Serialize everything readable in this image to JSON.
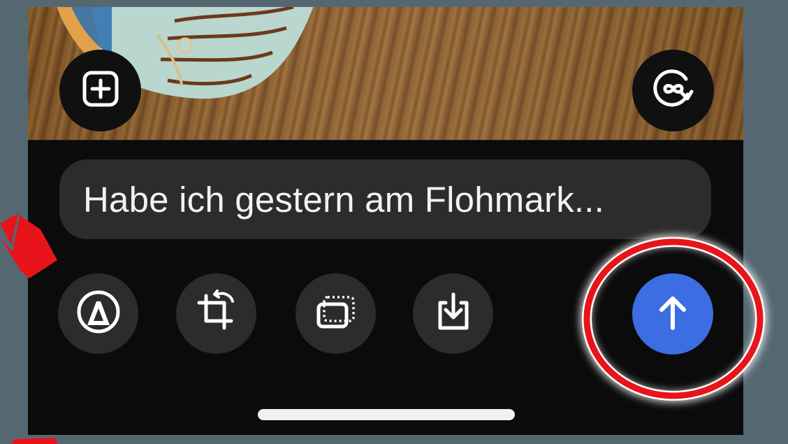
{
  "caption": {
    "text": "Habe ich gestern am Flohmark..."
  },
  "photo": {
    "icons": [
      "add-sticker-icon",
      "loop-icon"
    ]
  },
  "toolbar": {
    "icons": [
      "markup-pen-icon",
      "crop-rotate-icon",
      "aspect-ratio-icon",
      "download-icon",
      "send-arrow-icon"
    ]
  },
  "colors": {
    "background": "#556872",
    "sheet": "#0b0b0b",
    "button": "#2c2c2c",
    "send": "#3d6de3",
    "annotation": "#e8141b"
  }
}
